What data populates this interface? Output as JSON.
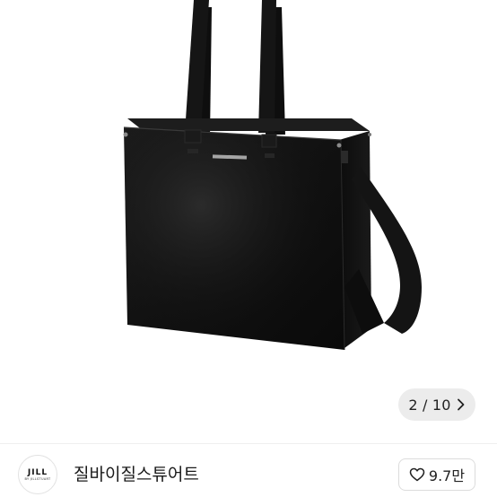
{
  "gallery": {
    "image_alt": "black tote bag",
    "brand_stamp": "JILL BY JILLSTUART",
    "counter_text": "2 / 10",
    "next_icon": "chevron-right-icon"
  },
  "seller": {
    "avatar_logo_main": "JILL",
    "avatar_logo_sub": "BY JILLSTUART",
    "name": "질바이질스튜어트"
  },
  "like": {
    "icon": "heart-outline-icon",
    "count": "9.7만"
  }
}
